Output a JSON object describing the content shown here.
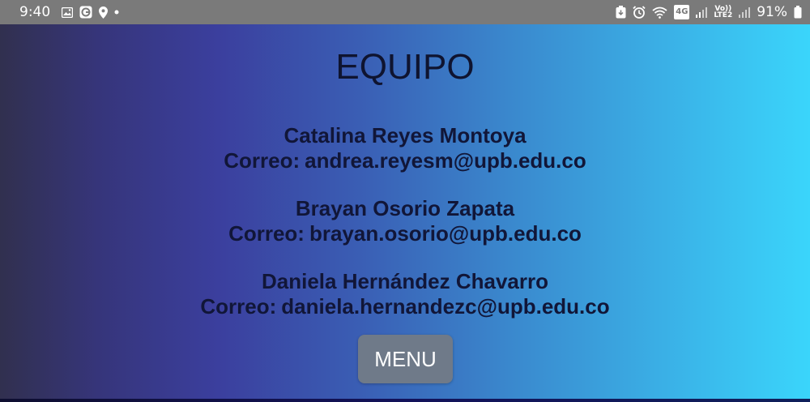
{
  "status_bar": {
    "time": "9:40",
    "battery_percent": "91%",
    "network_tag": "4G",
    "lte_tag_top": "Vo))",
    "lte_tag_bottom": "LTE2",
    "left_icons": [
      "image-icon",
      "app-icon",
      "location-icon",
      "dot-icon"
    ],
    "right_icons": [
      "data-saver-icon",
      "alarm-icon",
      "wifi-icon",
      "signal-icon",
      "lte-icon",
      "signal-icon",
      "battery-icon"
    ]
  },
  "page": {
    "title": "EQUIPO",
    "members": [
      {
        "name": "Catalina Reyes Montoya",
        "email_label": "Correo:",
        "email": "andrea.reyesm@upb.edu.co"
      },
      {
        "name": "Brayan Osorio Zapata",
        "email_label": "Correo:",
        "email": "brayan.osorio@upb.edu.co"
      },
      {
        "name": "Daniela Hernández Chavarro",
        "email_label": "Correo:",
        "email": "daniela.hernandezc@upb.edu.co"
      }
    ],
    "menu_button_label": "MENU"
  },
  "colors": {
    "status_bar_bg": "#7a7a7a",
    "gradient_start": "#31304f",
    "gradient_mid": "#3b3f9e",
    "gradient_end": "#3ad5fb",
    "text_dark": "#111638",
    "menu_button_bg": "#6f7a89"
  }
}
